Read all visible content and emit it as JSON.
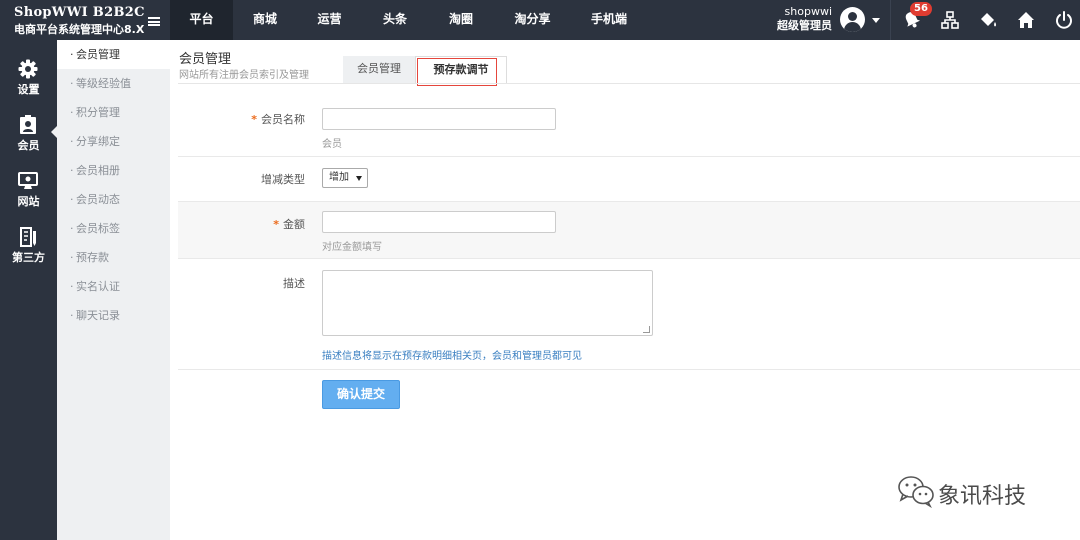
{
  "brand": {
    "name": "ShopWWI B2B2C",
    "subtitle": "电商平台系统管理中心8.X"
  },
  "nav": [
    {
      "label": "平台",
      "active": true
    },
    {
      "label": "商城"
    },
    {
      "label": "运营"
    },
    {
      "label": "头条"
    },
    {
      "label": "淘圈"
    },
    {
      "label": "淘分享"
    },
    {
      "label": "手机端"
    }
  ],
  "user": {
    "name": "shopwwi",
    "role": "超级管理员"
  },
  "notifications": {
    "count": "56"
  },
  "toolbar_icons": [
    "bell-icon",
    "sitemap-icon",
    "paint-bucket-icon",
    "home-icon",
    "power-icon"
  ],
  "sidebar": [
    {
      "label": "设置",
      "icon": "gear-icon"
    },
    {
      "label": "会员",
      "icon": "member-card-icon",
      "active": true
    },
    {
      "label": "网站",
      "icon": "monitor-icon"
    },
    {
      "label": "第三方",
      "icon": "document-pen-icon"
    }
  ],
  "submenu": [
    {
      "label": "会员管理",
      "active": true
    },
    {
      "label": "等级经验值"
    },
    {
      "label": "积分管理"
    },
    {
      "label": "分享绑定"
    },
    {
      "label": "会员相册"
    },
    {
      "label": "会员动态"
    },
    {
      "label": "会员标签"
    },
    {
      "label": "预存款"
    },
    {
      "label": "实名认证"
    },
    {
      "label": "聊天记录"
    }
  ],
  "page": {
    "title": "会员管理",
    "description": "网站所有注册会员索引及管理"
  },
  "tabs": [
    {
      "label": "会员管理"
    },
    {
      "label": "预存款调节",
      "active": true
    }
  ],
  "form": {
    "member_name": {
      "label": "会员名称",
      "required": "*",
      "value": "",
      "hint": "会员"
    },
    "change_type": {
      "label": "增减类型",
      "selected": "增加"
    },
    "amount": {
      "label": "金额",
      "required": "*",
      "value": "",
      "hint": "对应金额填写"
    },
    "description": {
      "label": "描述",
      "value": "",
      "hint": "描述信息将显示在预存款明细相关页，会员和管理员都可见"
    },
    "submit_label": "确认提交"
  },
  "watermark": {
    "text": "象讯科技"
  },
  "colors": {
    "topbar": "#2c333f",
    "submenu_bg": "#eef0f2",
    "submit": "#63aef0",
    "badge": "#e03c31",
    "required": "#ec6b1c",
    "tab_highlight": "#e5463c"
  }
}
